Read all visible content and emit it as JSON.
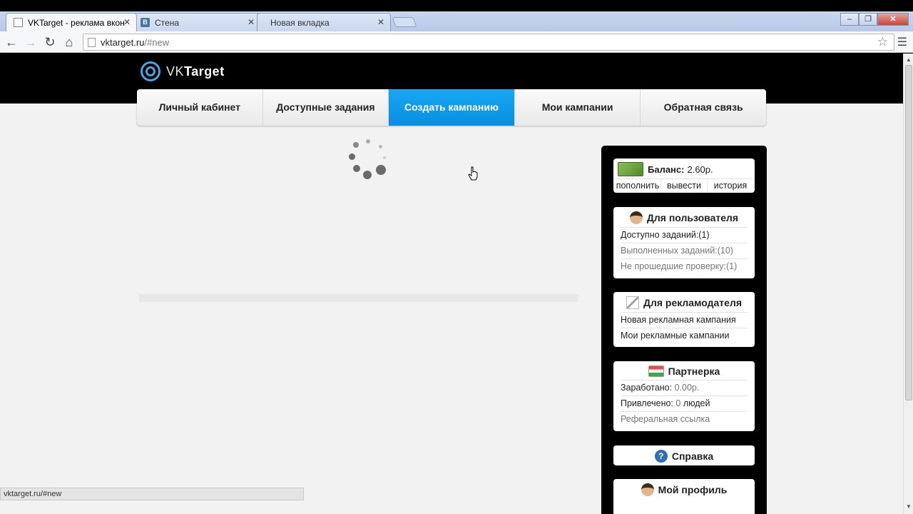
{
  "browser": {
    "tabs": [
      {
        "title": "VKTarget - реклама вкон",
        "close": "✕",
        "favicon": "doc-icon"
      },
      {
        "title": "Стена",
        "close": "✕",
        "favicon": "vk-icon"
      },
      {
        "title": "Новая вкладка",
        "close": "✕",
        "favicon": ""
      }
    ],
    "url_host": "vktarget.ru",
    "url_path": "/#new",
    "status_url": "vktarget.ru/#new"
  },
  "site": {
    "logo_prefix": "VK",
    "logo_suffix": "Target",
    "nav": [
      {
        "label": "Личный кабинет"
      },
      {
        "label": "Доступные задания"
      },
      {
        "label": "Создать кампанию"
      },
      {
        "label": "Мои кампании"
      },
      {
        "label": "Обратная связь"
      }
    ],
    "active_nav": "Создать кампанию",
    "accent_color": "#0f9bea"
  },
  "sidebar": {
    "balance": {
      "label": "Баланс:",
      "value": "2.60р.",
      "actions": [
        "пополнить",
        "вывести",
        "история"
      ]
    },
    "user": {
      "title": "Для пользователя",
      "available": "Доступно заданий:(1)",
      "completed": "Выполненных заданий:(10)",
      "failed": "Не прошедшие проверку:(1)"
    },
    "advertiser": {
      "title": "Для рекламодателя",
      "new_campaign": "Новая рекламная кампания",
      "my_campaigns": "Мои рекламные кампании"
    },
    "partner": {
      "title": "Партнерка",
      "earned_label": "Заработано:",
      "earned_value": "0.00р.",
      "referred_label": "Привлечено:",
      "referred_value": "0",
      "referred_unit": "людей",
      "ref_link": "Реферальная ссылка"
    },
    "help": {
      "title": "Справка"
    },
    "profile": {
      "title": "Мой профиль"
    }
  }
}
